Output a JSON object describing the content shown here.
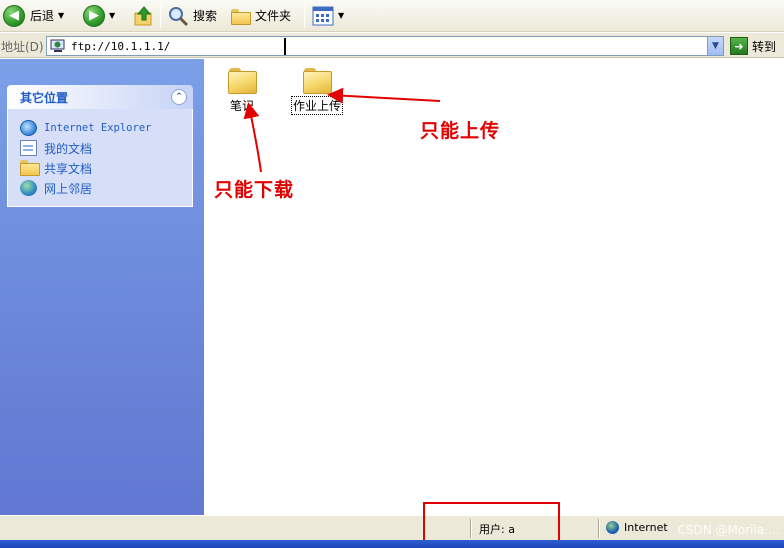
{
  "toolbar": {
    "back_label": "后退",
    "search_label": "搜索",
    "folders_label": "文件夹"
  },
  "address": {
    "label": "地址(D)",
    "value": "ftp://10.1.1.1/",
    "go_label": "转到"
  },
  "taskpane": {
    "title": "其它位置",
    "links": [
      {
        "label": "Internet Explorer",
        "icon": "internet-explorer-icon"
      },
      {
        "label": "我的文档",
        "icon": "documents-icon"
      },
      {
        "label": "共享文档",
        "icon": "folder-icon"
      },
      {
        "label": "网上邻居",
        "icon": "network-icon"
      }
    ]
  },
  "folders": [
    {
      "label": "笔记"
    },
    {
      "label": "作业上传"
    }
  ],
  "annotations": {
    "upload_only": "只能上传",
    "download_only": "只能下载",
    "colors": {
      "annotation": "#e30000"
    }
  },
  "status": {
    "user": "用户: a",
    "zone": "Internet"
  },
  "watermark": "CSDN @Moriia…."
}
